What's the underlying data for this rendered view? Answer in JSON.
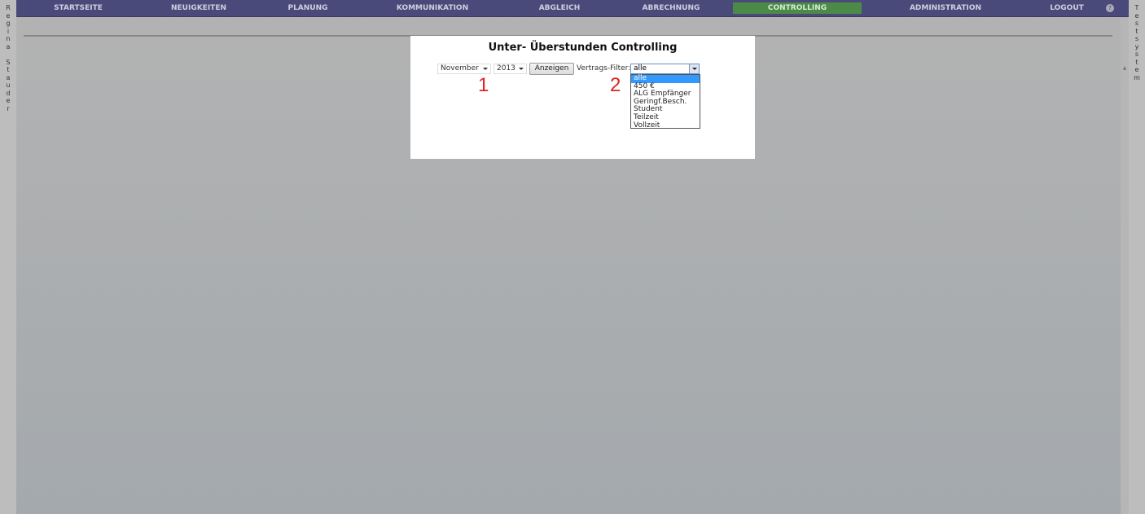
{
  "user_name": [
    "R",
    "e",
    "g",
    "i",
    "n",
    "a",
    "",
    "S",
    "t",
    "a",
    "u",
    "d",
    "e",
    "r"
  ],
  "system_name": [
    "T",
    "e",
    "s",
    "t",
    "s",
    "y",
    "s",
    "t",
    "e",
    "m"
  ],
  "nav": {
    "items": [
      "STARTSEITE",
      "NEUIGKEITEN",
      "PLANUNG",
      "KOMMUNIKATION",
      "ABGLEICH",
      "ABRECHNUNG",
      "CONTROLLING",
      "ADMINISTRATION",
      "LOGOUT"
    ],
    "active": "CONTROLLING",
    "help_icon": "?"
  },
  "page": {
    "title": "Unter- Überstunden Controlling",
    "month": "November",
    "year": "2013",
    "show_button": "Anzeigen",
    "filter_label": "Vertrags-Filter:",
    "filter_value": "alle",
    "filter_options": [
      "alle",
      "450 €",
      "ALG Empfänger",
      "Geringf.Besch.",
      "Student",
      "Teilzeit",
      "Vollzeit"
    ],
    "highlighted_option": "alle"
  },
  "annotations": [
    "1",
    "2"
  ],
  "colors": {
    "nav": "#4a4a7a",
    "active": "#4c8a48",
    "highlight": "#3399ff",
    "annotation": "#e02020"
  }
}
